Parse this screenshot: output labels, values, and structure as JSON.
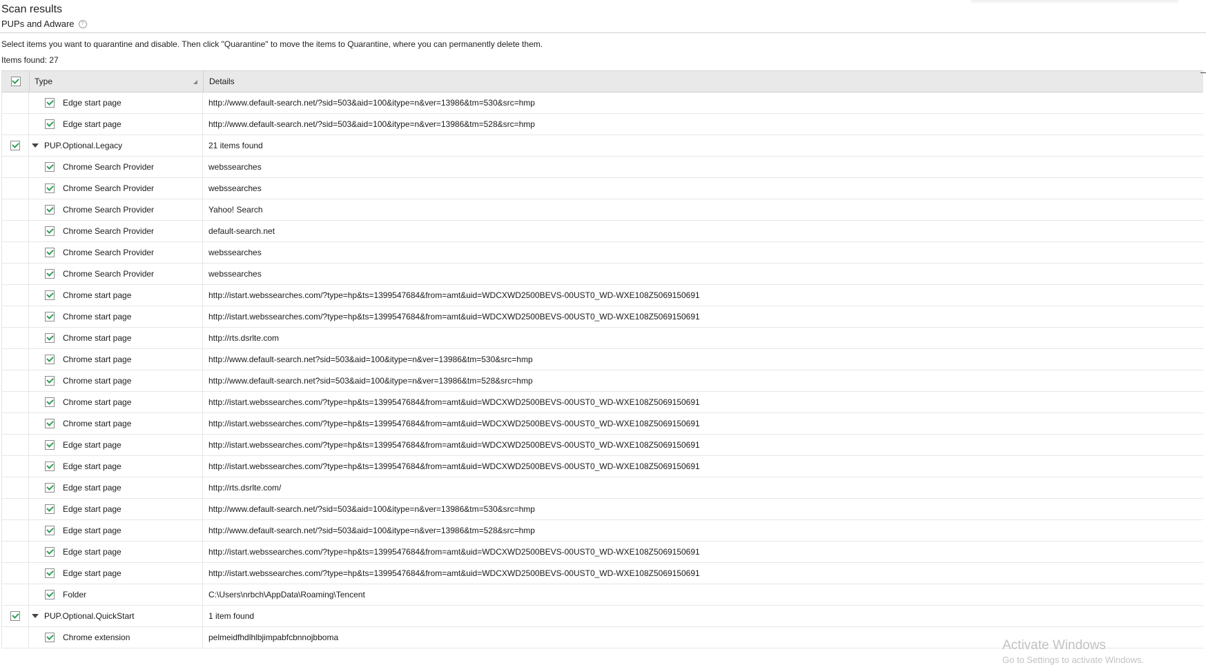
{
  "header": {
    "title": "Scan results",
    "subtitle": "PUPs and Adware",
    "help_glyph": "?"
  },
  "instructions": "Select items you want to quarantine and disable. Then click \"Quarantine\" to move the items to Quarantine, where you can permanently delete them.",
  "items_found": "Items found: 27",
  "table": {
    "columns": {
      "type": "Type",
      "details": "Details"
    },
    "rows": [
      {
        "kind": "child",
        "type": "Edge start page",
        "details": "http://www.default-search.net/?sid=503&aid=100&itype=n&ver=13986&tm=530&src=hmp"
      },
      {
        "kind": "child",
        "type": "Edge start page",
        "details": "http://www.default-search.net/?sid=503&aid=100&itype=n&ver=13986&tm=528&src=hmp"
      },
      {
        "kind": "group",
        "type": "PUP.Optional.Legacy",
        "details": "21 items found"
      },
      {
        "kind": "child",
        "type": "Chrome Search Provider",
        "details": "webssearches"
      },
      {
        "kind": "child",
        "type": "Chrome Search Provider",
        "details": "webssearches"
      },
      {
        "kind": "child",
        "type": "Chrome Search Provider",
        "details": "Yahoo! Search"
      },
      {
        "kind": "child",
        "type": "Chrome Search Provider",
        "details": "default-search.net"
      },
      {
        "kind": "child",
        "type": "Chrome Search Provider",
        "details": "webssearches"
      },
      {
        "kind": "child",
        "type": "Chrome Search Provider",
        "details": "webssearches"
      },
      {
        "kind": "child",
        "type": "Chrome start page",
        "details": "http://istart.webssearches.com/?type=hp&ts=1399547684&from=amt&uid=WDCXWD2500BEVS-00UST0_WD-WXE108Z5069150691"
      },
      {
        "kind": "child",
        "type": "Chrome start page",
        "details": "http://istart.webssearches.com/?type=hp&ts=1399547684&from=amt&uid=WDCXWD2500BEVS-00UST0_WD-WXE108Z5069150691"
      },
      {
        "kind": "child",
        "type": "Chrome start page",
        "details": "http://rts.dsrlte.com"
      },
      {
        "kind": "child",
        "type": "Chrome start page",
        "details": "http://www.default-search.net?sid=503&aid=100&itype=n&ver=13986&tm=530&src=hmp"
      },
      {
        "kind": "child",
        "type": "Chrome start page",
        "details": "http://www.default-search.net?sid=503&aid=100&itype=n&ver=13986&tm=528&src=hmp"
      },
      {
        "kind": "child",
        "type": "Chrome start page",
        "details": "http://istart.webssearches.com/?type=hp&ts=1399547684&from=amt&uid=WDCXWD2500BEVS-00UST0_WD-WXE108Z5069150691"
      },
      {
        "kind": "child",
        "type": "Chrome start page",
        "details": "http://istart.webssearches.com/?type=hp&ts=1399547684&from=amt&uid=WDCXWD2500BEVS-00UST0_WD-WXE108Z5069150691"
      },
      {
        "kind": "child",
        "type": "Edge start page",
        "details": "http://istart.webssearches.com/?type=hp&ts=1399547684&from=amt&uid=WDCXWD2500BEVS-00UST0_WD-WXE108Z5069150691"
      },
      {
        "kind": "child",
        "type": "Edge start page",
        "details": "http://istart.webssearches.com/?type=hp&ts=1399547684&from=amt&uid=WDCXWD2500BEVS-00UST0_WD-WXE108Z5069150691"
      },
      {
        "kind": "child",
        "type": "Edge start page",
        "details": "http://rts.dsrlte.com/"
      },
      {
        "kind": "child",
        "type": "Edge start page",
        "details": "http://www.default-search.net/?sid=503&aid=100&itype=n&ver=13986&tm=530&src=hmp"
      },
      {
        "kind": "child",
        "type": "Edge start page",
        "details": "http://www.default-search.net/?sid=503&aid=100&itype=n&ver=13986&tm=528&src=hmp"
      },
      {
        "kind": "child",
        "type": "Edge start page",
        "details": "http://istart.webssearches.com/?type=hp&ts=1399547684&from=amt&uid=WDCXWD2500BEVS-00UST0_WD-WXE108Z5069150691"
      },
      {
        "kind": "child",
        "type": "Edge start page",
        "details": "http://istart.webssearches.com/?type=hp&ts=1399547684&from=amt&uid=WDCXWD2500BEVS-00UST0_WD-WXE108Z5069150691"
      },
      {
        "kind": "child",
        "type": "Folder",
        "details": "C:\\Users\\nrbch\\AppData\\Roaming\\Tencent"
      },
      {
        "kind": "group",
        "type": "PUP.Optional.QuickStart",
        "details": "1 item found"
      },
      {
        "kind": "child",
        "type": "Chrome extension",
        "details": "pelmeidfhdlhlbjimpabfcbnnojbboma"
      }
    ]
  },
  "watermark": {
    "line1": "Activate Windows",
    "line2": "Go to Settings to activate Windows."
  },
  "colors": {
    "check": "#2f9d57",
    "header_bg": "#e9e9e9",
    "watermark": "#c2c2c2"
  }
}
